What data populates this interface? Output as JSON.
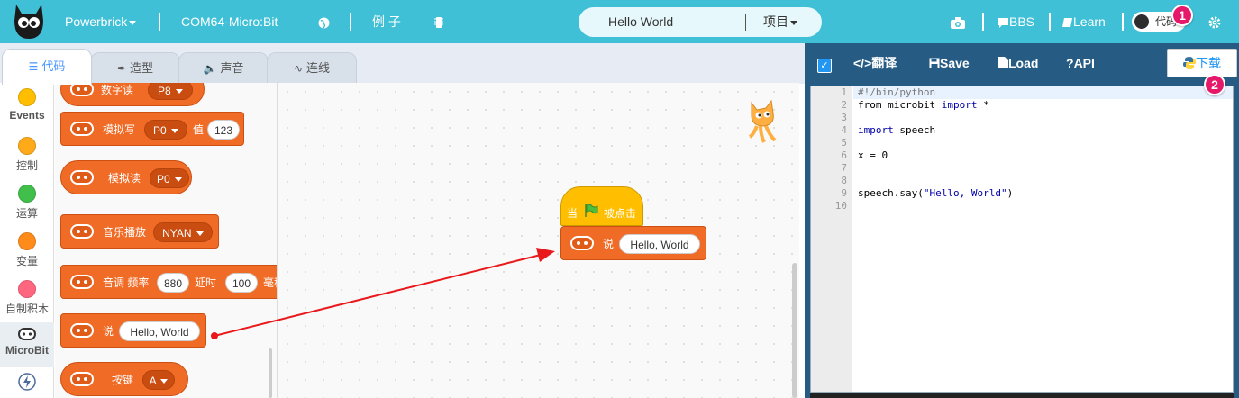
{
  "topbar": {
    "app_name": "Powerbrick",
    "port": "COM64-Micro:Bit",
    "examples": "例 子",
    "project_name": "Hello World",
    "project_menu": "项目",
    "bbs": "BBS",
    "learn": "Learn",
    "toggle_label": "代码"
  },
  "tabs": [
    {
      "label": "代码",
      "icon": "code-icon"
    },
    {
      "label": "造型",
      "icon": "brush-icon"
    },
    {
      "label": "声音",
      "icon": "speaker-icon"
    },
    {
      "label": "连线",
      "icon": "wire-icon"
    }
  ],
  "categories": [
    {
      "label": "Events",
      "color": "#ffbf00"
    },
    {
      "label": "控制",
      "color": "#ffab19"
    },
    {
      "label": "运算",
      "color": "#40bf4a"
    },
    {
      "label": "变量",
      "color": "#ff8c1a"
    },
    {
      "label": "自制积木",
      "color": "#ff6680"
    },
    {
      "label": "MicroBit",
      "color": "#ffffff"
    }
  ],
  "palette": {
    "digital_read": {
      "label": "数字读",
      "pin": "P8"
    },
    "analog_write": {
      "label": "模拟写",
      "pin": "P0",
      "value_label": "值",
      "value": "123"
    },
    "analog_read": {
      "label": "模拟读",
      "pin": "P0"
    },
    "music_play": {
      "label": "音乐播放",
      "melody": "NYAN"
    },
    "tone": {
      "label": "音调 频率",
      "freq": "880",
      "delay_label": "延时",
      "delay": "100",
      "unit": "毫秒"
    },
    "say": {
      "label": "说",
      "text": "Hello, World"
    },
    "button": {
      "label": "按键",
      "key": "A"
    }
  },
  "workspace": {
    "hat_when": "当",
    "hat_clicked": "被点击",
    "say_label": "说",
    "say_text": "Hello, World"
  },
  "code_panel": {
    "translate": "翻译",
    "save": "Save",
    "load": "Load",
    "api": "API",
    "download": "下载",
    "badge1": "1",
    "badge2": "2",
    "line_numbers": [
      "1",
      "2",
      "3",
      "4",
      "5",
      "6",
      "7",
      "8",
      "9",
      "10"
    ],
    "lines": {
      "l1": "#!/bin/python",
      "l2a": "from microbit ",
      "l2b": "import",
      "l2c": " *",
      "l4a": "import",
      "l4b": " speech",
      "l6": "x = 0",
      "l9a": "speech.say(",
      "l9b": "\"Hello, World\"",
      "l9c": ")"
    }
  },
  "colors": {
    "topbar": "#3fc0d6",
    "block_orange": "#f06b26",
    "hat_yellow": "#ffbf00",
    "code_panel_bg": "#265b84",
    "badge": "#e5186a"
  }
}
